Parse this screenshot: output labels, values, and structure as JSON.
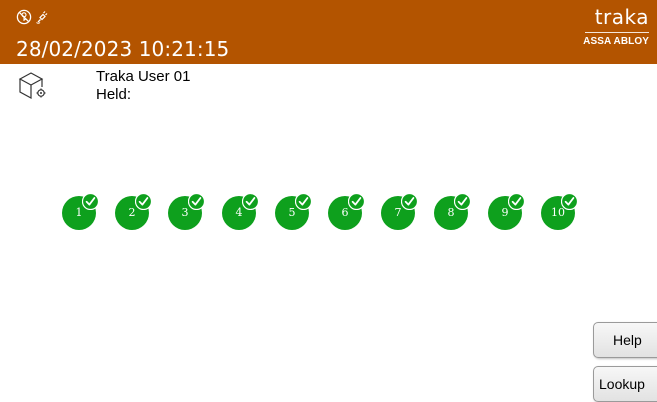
{
  "header": {
    "datetime": "28/02/2023 10:21:15",
    "status_icons": [
      "no-key-icon",
      "power-plug-icon"
    ],
    "brand_name": "traka",
    "brand_subtitle": "ASSA ABLOY",
    "background_color": "#b35400"
  },
  "user": {
    "name": "Traka User 01",
    "held_label": "Held:"
  },
  "keys": [
    {
      "label": "1",
      "status": "returned"
    },
    {
      "label": "2",
      "status": "returned"
    },
    {
      "label": "3",
      "status": "returned"
    },
    {
      "label": "4",
      "status": "returned"
    },
    {
      "label": "5",
      "status": "returned"
    },
    {
      "label": "6",
      "status": "returned"
    },
    {
      "label": "7",
      "status": "returned"
    },
    {
      "label": "8",
      "status": "returned"
    },
    {
      "label": "9",
      "status": "returned"
    },
    {
      "label": "10",
      "status": "returned"
    }
  ],
  "key_color": "#0ea01d",
  "buttons": {
    "help_label": "Help",
    "lookup_label": "Lookup"
  }
}
